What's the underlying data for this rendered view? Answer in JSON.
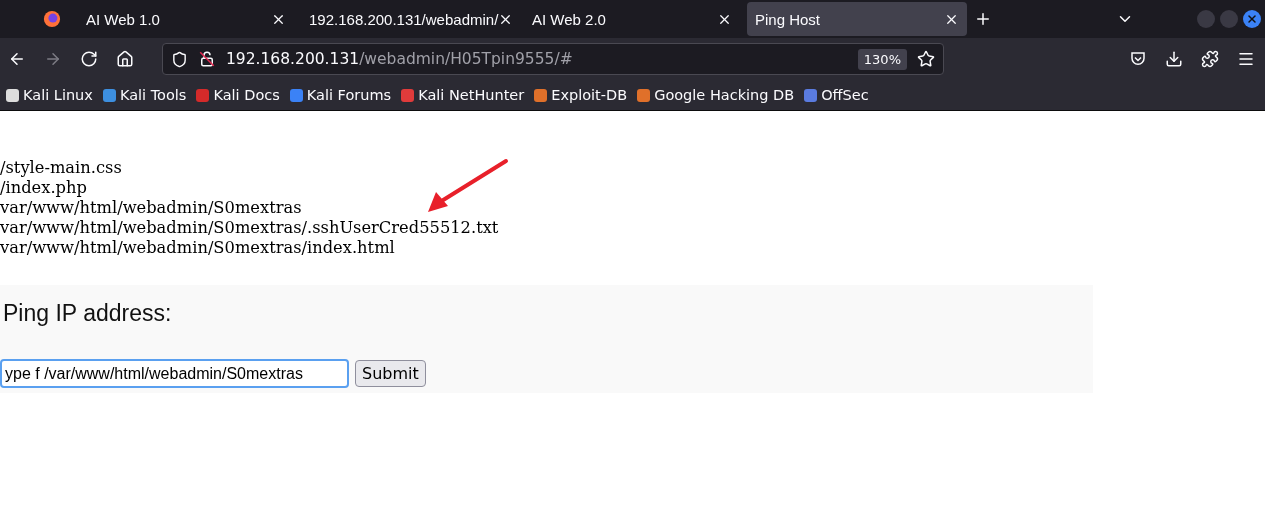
{
  "tabs": [
    {
      "title": "AI Web 1.0",
      "selected": false
    },
    {
      "title": "192.168.200.131/webadmin/",
      "selected": false
    },
    {
      "title": "AI Web 2.0",
      "selected": false
    },
    {
      "title": "Ping Host",
      "selected": true
    }
  ],
  "nav": [
    {
      "kind": "back",
      "disabled": false
    },
    {
      "kind": "forward",
      "disabled": true
    },
    {
      "kind": "reload",
      "disabled": false
    },
    {
      "kind": "home",
      "disabled": false
    }
  ],
  "address": {
    "host": "192.168.200.131",
    "path": "/webadmin/H05Tpin9555/#",
    "zoom": "130%"
  },
  "bookmarks": [
    {
      "label": "Kali Linux",
      "color": "#dddddd"
    },
    {
      "label": "Kali Tools",
      "color": "#3d8fe0"
    },
    {
      "label": "Kali Docs",
      "color": "#d42a2a"
    },
    {
      "label": "Kali Forums",
      "color": "#3b82f6"
    },
    {
      "label": "Kali NetHunter",
      "color": "#e03b3b"
    },
    {
      "label": "Exploit-DB",
      "color": "#e0702a"
    },
    {
      "label": "Google Hacking DB",
      "color": "#e0702a"
    },
    {
      "label": "OffSec",
      "color": "#5a7be0"
    }
  ],
  "output_lines": [
    "/style-main.css",
    "/index.php",
    "var/www/html/webadmin/S0mextras",
    "var/www/html/webadmin/S0mextras/.sshUserCred55512.txt",
    "var/www/html/webadmin/S0mextras/index.html"
  ],
  "form": {
    "heading": "Ping IP address:",
    "value": "ype f /var/www/html/webadmin/S0mextras",
    "button": "Submit"
  }
}
